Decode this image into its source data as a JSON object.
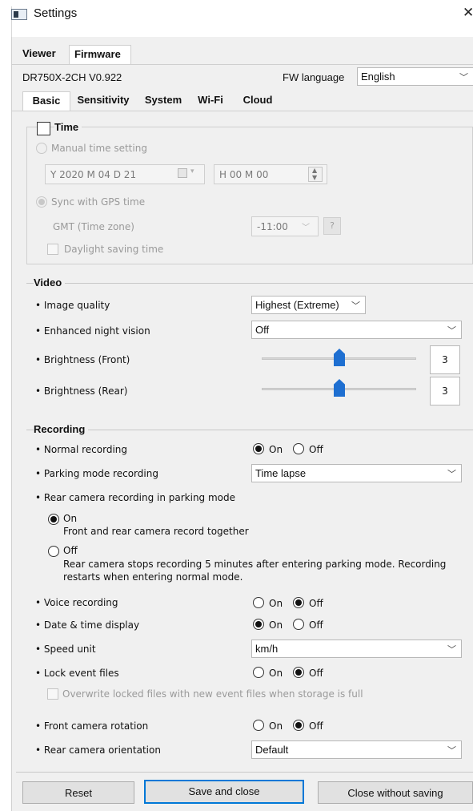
{
  "window": {
    "title": "Settings",
    "close_glyph": "✕"
  },
  "top_tabs": [
    {
      "label": "Viewer",
      "active": false
    },
    {
      "label": "Firmware",
      "active": true
    }
  ],
  "device": {
    "model": "DR750X-2CH V0.922",
    "fw_language_label": "FW language",
    "fw_language_value": "English"
  },
  "sub_tabs": [
    {
      "label": "Basic",
      "active": true
    },
    {
      "label": "Sensitivity",
      "active": false
    },
    {
      "label": "System",
      "active": false
    },
    {
      "label": "Wi-Fi",
      "active": false
    },
    {
      "label": "Cloud",
      "active": false
    }
  ],
  "time": {
    "title": "Time",
    "checked": false,
    "manual_label": "Manual time setting",
    "date_value": "Y 2020 M 04 D 21",
    "time_value": "H 00 M 00",
    "gps_label": "Sync with GPS time",
    "gmt_label": "GMT (Time zone)",
    "gmt_value": "-11:00",
    "help_glyph": "?",
    "dst_label": "Daylight saving time"
  },
  "video": {
    "title": "Video",
    "image_quality_label": "• Image quality",
    "image_quality_value": "Highest (Extreme)",
    "night_vision_label": "• Enhanced night vision",
    "night_vision_value": "Off",
    "brightness_front_label": "• Brightness (Front)",
    "brightness_front_value": "3",
    "brightness_rear_label": "• Brightness (Rear)",
    "brightness_rear_value": "3",
    "brightness_scale_fraction": 0.5
  },
  "recording": {
    "title": "Recording",
    "normal_label": "• Normal recording",
    "on_label": "On",
    "off_label": "Off",
    "parking_label": "• Parking mode recording",
    "parking_value": "Time lapse",
    "rear_parking_label": "• Rear camera recording in parking mode",
    "rear_on_label": "On",
    "rear_on_desc": "Front and rear camera record together",
    "rear_off_label": "Off",
    "rear_off_desc_1": "Rear camera stops recording 5 minutes after entering parking mode. Recording",
    "rear_off_desc_2": "restarts when entering normal mode.",
    "voice_label": "• Voice recording",
    "datetime_label": "• Date & time display",
    "speed_label": "• Speed unit",
    "speed_value": "km/h",
    "lock_label": "• Lock event files",
    "overwrite_label": "Overwrite locked files with new event files when storage is full",
    "front_rotation_label": "• Front camera rotation",
    "rear_orientation_label": "• Rear camera orientation",
    "rear_orientation_value": "Default"
  },
  "buttons": {
    "reset": "Reset",
    "save_close": "Save and close",
    "close_no_save": "Close without saving"
  },
  "colors": {
    "accent": "#0078d7",
    "slider": "#1e6fd1"
  }
}
